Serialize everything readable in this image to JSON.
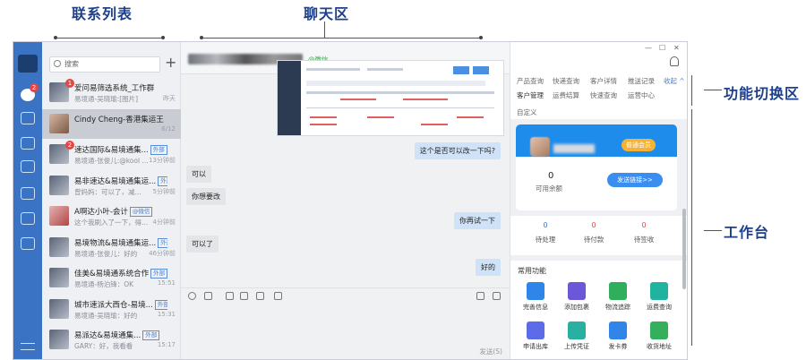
{
  "annotations": {
    "contacts": "联系列表",
    "chat": "聊天区",
    "switch": "功能切换区",
    "workbench": "工作台"
  },
  "sidebar": {
    "badge": "2"
  },
  "contacts": {
    "search_placeholder": "搜索",
    "add": "+",
    "items": [
      {
        "name": "爱问易筛选系统_工作群",
        "sub": "易境通-吴晓瑜:[图片]",
        "time": "昨天",
        "badge": "1",
        "tag": ""
      },
      {
        "name": "Cindy Cheng-香港集运王（...",
        "sub": "",
        "time": "6/12",
        "badge": "",
        "tag": ""
      },
      {
        "name": "速达国际&易境通集...",
        "sub": "易境通-张俊儿:@kool ...",
        "time": "13分钟前",
        "badge": "2",
        "tag": "外部"
      },
      {
        "name": "易非速达&易境通集运...",
        "sub": "曾妈妈：可以了，减...",
        "time": "5分钟前",
        "badge": "",
        "tag": "外部"
      },
      {
        "name": "A啊达小叶-会计",
        "sub": "这个我刷入了一下，得...",
        "time": "4分钟前",
        "badge": "",
        "tag": "@微信"
      },
      {
        "name": "易境物流&易境通集运...",
        "sub": "易境通-张俊儿：好的",
        "time": "46分钟前",
        "badge": "",
        "tag": "外部"
      },
      {
        "name": "佳美&易境通系统合作",
        "sub": "易境通-杨泊锋：OK",
        "time": "15:51",
        "badge": "",
        "tag": "外部"
      },
      {
        "name": "城市速派大西仓-易境...",
        "sub": "易境通-吴晓瑜：好的",
        "time": "15:31",
        "badge": "",
        "tag": "外部"
      },
      {
        "name": "易派达&易境通集...",
        "sub": "GARY：好，我看看",
        "time": "15:17",
        "badge": "",
        "tag": "外部"
      }
    ]
  },
  "chat": {
    "source": "@微信",
    "messages": [
      {
        "dir": "out",
        "text": "这个是否可以改一下吗?"
      },
      {
        "dir": "in",
        "text": "可以"
      },
      {
        "dir": "in",
        "text": "你想要改"
      },
      {
        "dir": "out",
        "text": "你再试一下"
      },
      {
        "dir": "in",
        "text": "可以了"
      },
      {
        "dir": "out",
        "text": "好的"
      }
    ],
    "send": "发送(S)"
  },
  "window": {
    "min": "—",
    "max": "☐",
    "close": "✕"
  },
  "tabs": {
    "row1": [
      "产品查询",
      "快递查询",
      "客户详情",
      "推送记录",
      "收起 ^"
    ],
    "row2": [
      "客户管理",
      "运费结算",
      "快速查询",
      "运营中心"
    ],
    "row3": [
      "自定义"
    ]
  },
  "workbench": {
    "vip": "普通会员",
    "balance_value": "0",
    "balance_label": "可用余额",
    "action": "发送链接>>",
    "stats": [
      {
        "value": "0",
        "label": "待处理"
      },
      {
        "value": "0",
        "label": "待付款"
      },
      {
        "value": "0",
        "label": "待签收"
      }
    ],
    "common_title": "常用功能",
    "tiles": [
      {
        "label": "完善信息",
        "color": "#2f86e8"
      },
      {
        "label": "添加包裹",
        "color": "#6b58d8"
      },
      {
        "label": "物流追踪",
        "color": "#2fae5b"
      },
      {
        "label": "运费查询",
        "color": "#21b3a0"
      },
      {
        "label": "申请出库",
        "color": "#5c6be8"
      },
      {
        "label": "上传凭证",
        "color": "#2ab0a0"
      },
      {
        "label": "发卡券",
        "color": "#2f86e8"
      },
      {
        "label": "收货地址",
        "color": "#34b05c"
      }
    ]
  }
}
